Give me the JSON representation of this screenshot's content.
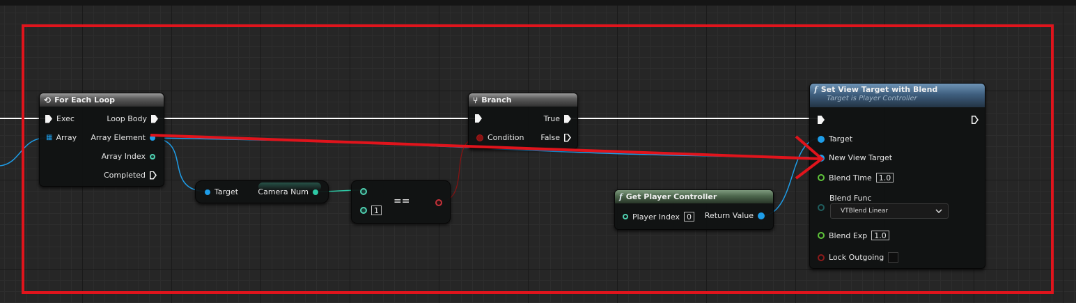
{
  "nodes": {
    "for_each_loop": {
      "title": "For Each Loop",
      "exec_in": "Exec",
      "loop_body": "Loop Body",
      "array": "Array",
      "array_element": "Array Element",
      "array_index": "Array Index",
      "completed": "Completed"
    },
    "camera_num": {
      "target": "Target",
      "camera_num": "Camera Num"
    },
    "equals": {
      "operator": "==",
      "value": "1"
    },
    "branch": {
      "title": "Branch",
      "true": "True",
      "condition": "Condition",
      "false": "False"
    },
    "get_player_controller": {
      "icon": "f",
      "title": "Get Player Controller",
      "player_index_label": "Player Index",
      "player_index_value": "0",
      "return_value": "Return Value"
    },
    "set_view_target": {
      "icon": "f",
      "title": "Set View Target with Blend",
      "subtitle": "Target is Player Controller",
      "target": "Target",
      "new_view_target": "New View Target",
      "blend_time_label": "Blend Time",
      "blend_time_value": "1.0",
      "blend_func_label": "Blend Func",
      "blend_func_value": "VTBlend Linear",
      "blend_exp_label": "Blend Exp",
      "blend_exp_value": "1.0",
      "lock_outgoing_label": "Lock Outgoing"
    }
  },
  "colors": {
    "object_pin": "#1e9de8",
    "int_pin": "#2ec9a5",
    "bool_pin": "#8a1212",
    "float_pin": "#5fc53a",
    "exec_wire": "#ffffff",
    "annotation": "#e0141c"
  },
  "icons": [
    "loop-icon",
    "branch-icon",
    "function-icon",
    "array-grid-icon",
    "dropdown-chevron-icon"
  ]
}
